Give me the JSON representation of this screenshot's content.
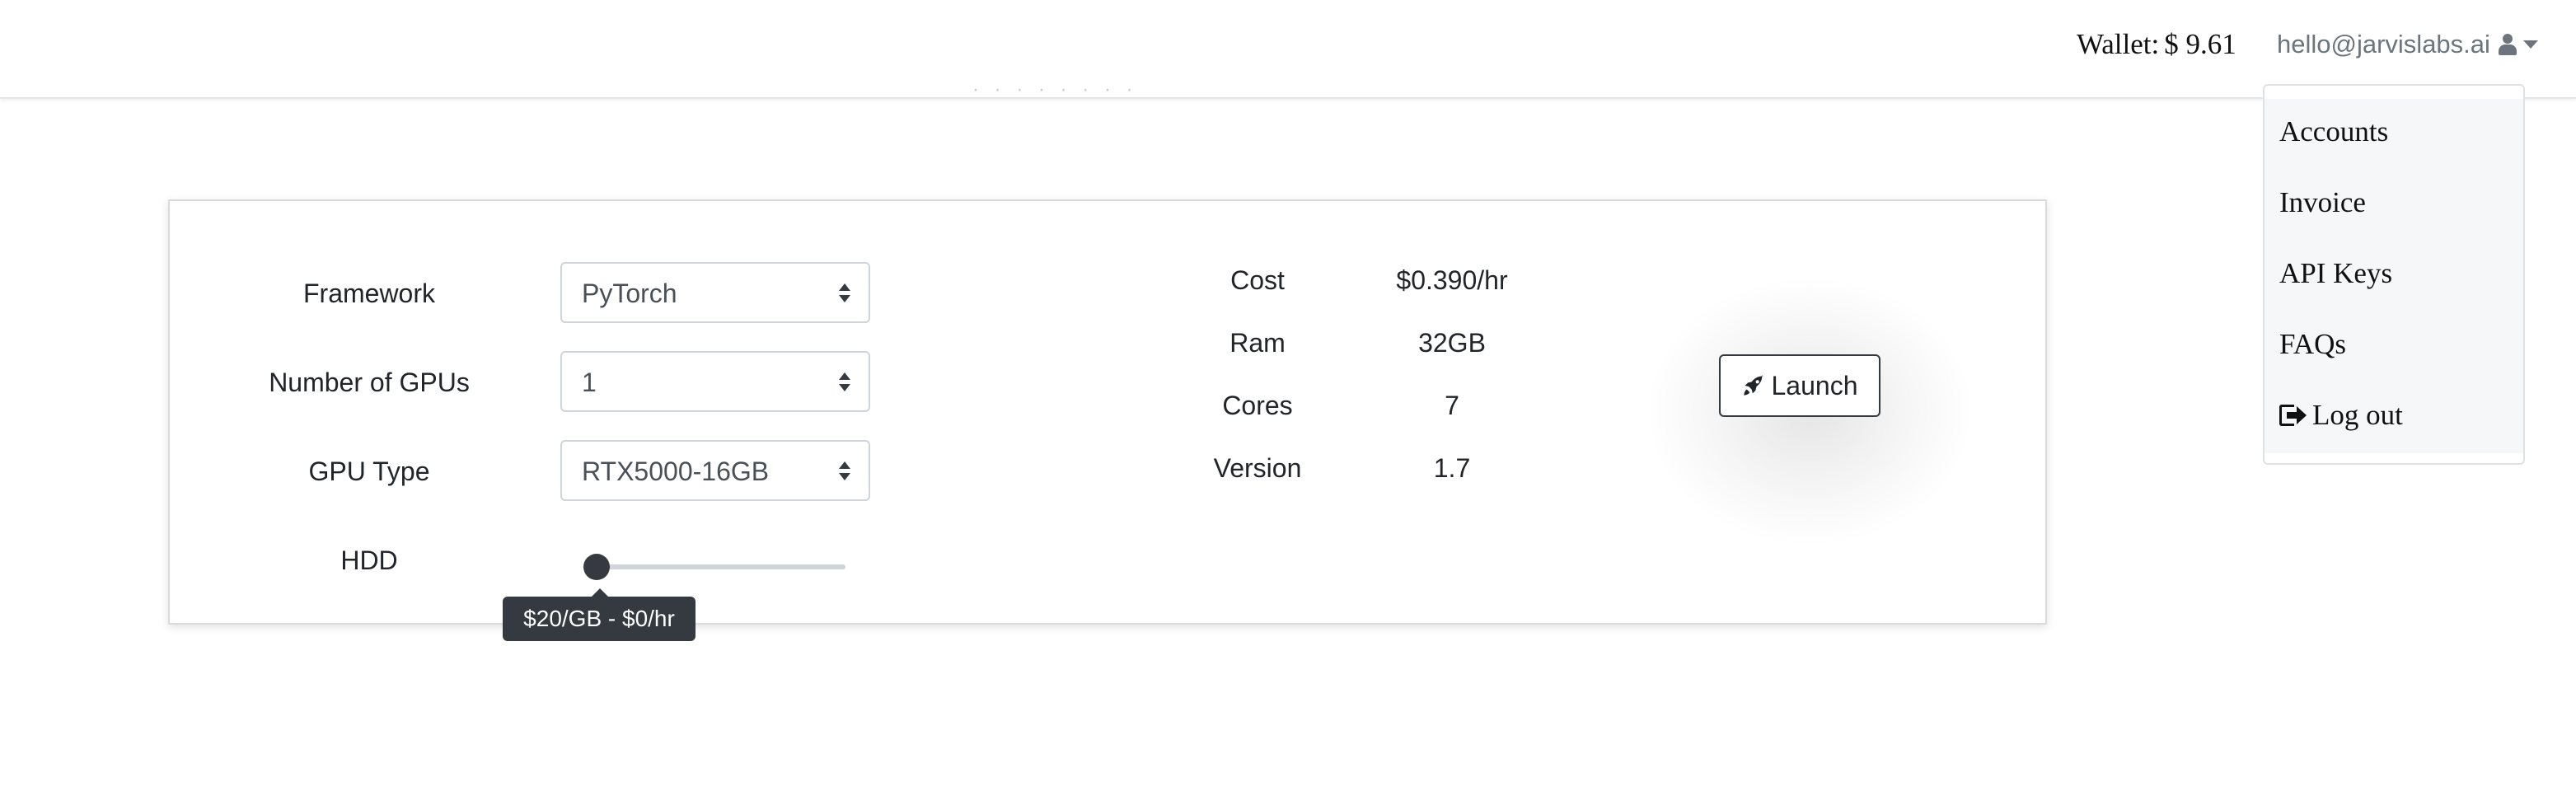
{
  "navbar": {
    "wallet_label": "Wallet:",
    "wallet_amount": "$ 9.61",
    "user_email": "hello@jarvislabs.ai",
    "user_icon": "user-icon",
    "partial_heading": "· · · · · · · ·"
  },
  "dropdown": {
    "items": [
      {
        "label": "Accounts"
      },
      {
        "label": "Invoice"
      },
      {
        "label": "API Keys"
      },
      {
        "label": "FAQs"
      },
      {
        "label": "Log out",
        "icon": "sign-out-icon"
      }
    ]
  },
  "form": {
    "framework_label": "Framework",
    "framework_value": "PyTorch",
    "gpus_label": "Number of GPUs",
    "gpus_value": "1",
    "gpu_type_label": "GPU Type",
    "gpu_type_value": "RTX5000-16GB",
    "hdd_label": "HDD",
    "hdd_slider_level": 0,
    "hdd_tooltip": "$20/GB - $0/hr"
  },
  "specs": {
    "cost_label": "Cost",
    "cost_value": "$0.390/hr",
    "ram_label": "Ram",
    "ram_value": "32GB",
    "cores_label": "Cores",
    "cores_value": "7",
    "version_label": "Version",
    "version_value": "1.7"
  },
  "actions": {
    "launch_label": "Launch",
    "launch_icon": "rocket-icon"
  },
  "colors": {
    "dark": "#343a40",
    "border": "#ced4da",
    "text": "#212529",
    "muted": "#6c757d"
  }
}
